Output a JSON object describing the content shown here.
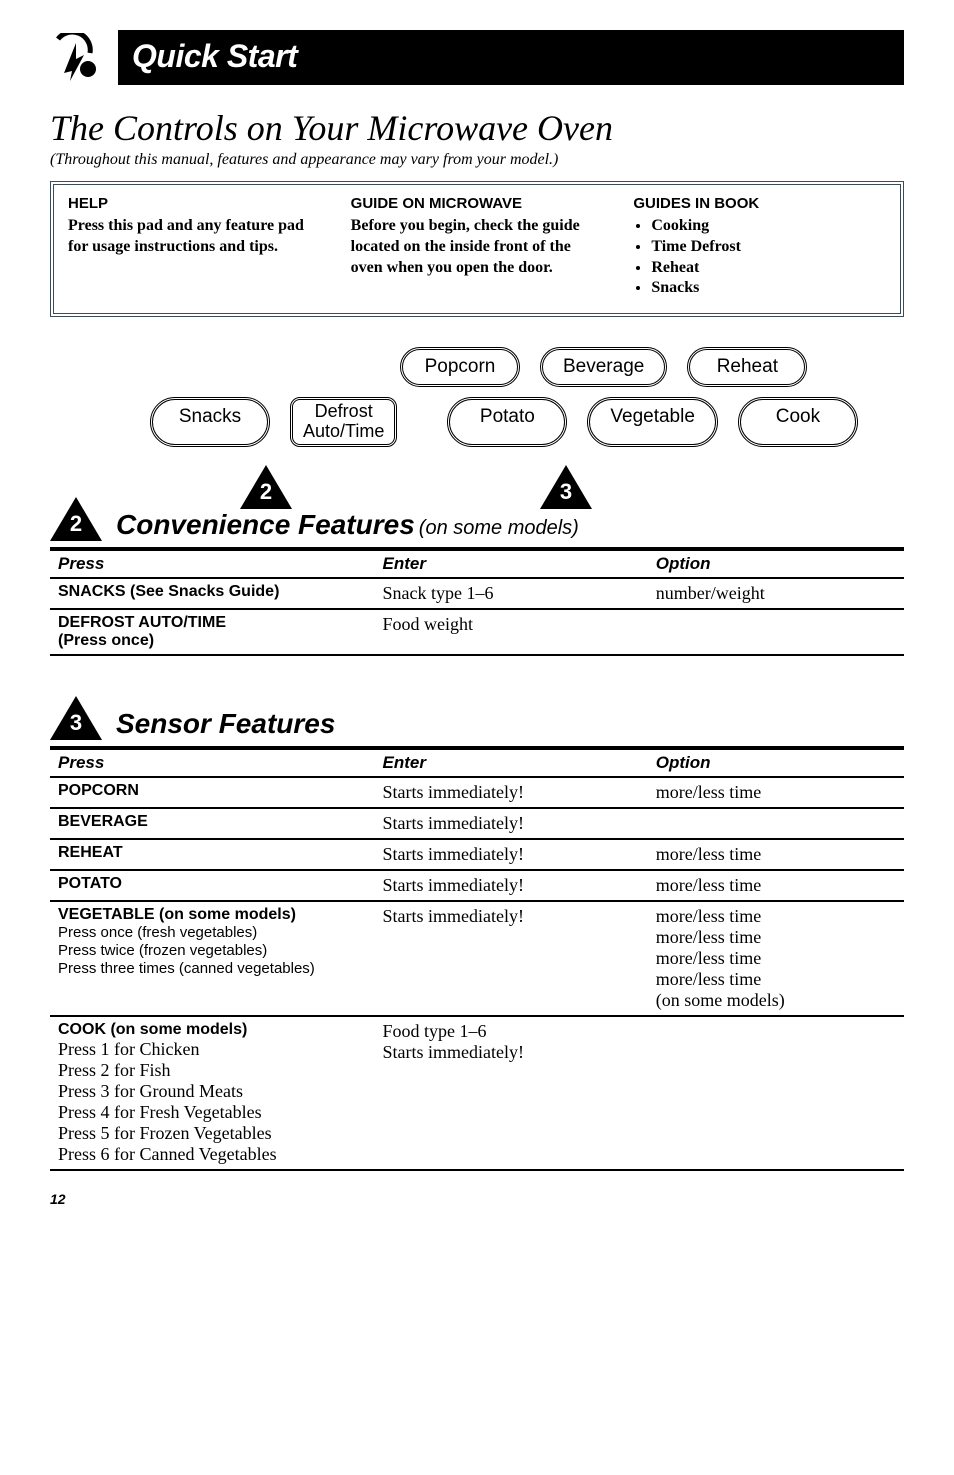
{
  "header": {
    "title": "Quick Start"
  },
  "section": {
    "title": "The Controls on Your Microwave Oven",
    "subtitle": "(Throughout this manual, features and appearance may vary from your model.)"
  },
  "guide": {
    "help": {
      "head": "HELP",
      "body": "Press this pad and any feature pad for usage instructions and tips."
    },
    "micro": {
      "head": "GUIDE ON MICROWAVE",
      "body": "Before you begin, check the guide located on the inside front of the oven when you open the door."
    },
    "book": {
      "head": "GUIDES IN BOOK",
      "items": [
        "Cooking",
        "Time Defrost",
        "Reheat",
        "Snacks"
      ]
    }
  },
  "buttons": {
    "popcorn": "Popcorn",
    "beverage": "Beverage",
    "reheat": "Reheat",
    "snacks": "Snacks",
    "defrost1": "Defrost",
    "defrost2": "Auto/Time",
    "potato": "Potato",
    "vegetable": "Vegetable",
    "cook": "Cook"
  },
  "markers": {
    "two": "2",
    "three": "3"
  },
  "convenience": {
    "heading": "Convenience Features",
    "sub": "(on some models)",
    "th": {
      "press": "Press",
      "enter": "Enter",
      "option": "Option"
    },
    "rows": [
      {
        "press": "SNACKS (See Snacks Guide)",
        "enter": "Snack type 1–6",
        "option": "number/weight"
      },
      {
        "press": "DEFROST AUTO/TIME",
        "press2": "(Press once)",
        "enter": "Food weight",
        "option": ""
      }
    ]
  },
  "sensor": {
    "heading": "Sensor Features",
    "th": {
      "press": "Press",
      "enter": "Enter",
      "option": "Option"
    },
    "rows": {
      "popcorn": {
        "p": "POPCORN",
        "e": "Starts immediately!",
        "o": "more/less time"
      },
      "beverage": {
        "p": "BEVERAGE",
        "e": "Starts immediately!",
        "o": ""
      },
      "reheat": {
        "p": "REHEAT",
        "e": "Starts immediately!",
        "o": "more/less time"
      },
      "potato": {
        "p": "POTATO",
        "e": "Starts immediately!",
        "o": "more/less time"
      },
      "veg": {
        "p": "VEGETABLE (on some models)",
        "s1": "Press once (fresh vegetables)",
        "s2": "Press twice (frozen vegetables)",
        "s3": "Press three times (canned vegetables)",
        "e": "Starts immediately!",
        "o1": "more/less time",
        "o2": "more/less time",
        "o3": "more/less time",
        "o4": "more/less time",
        "o5": "(on some models)"
      },
      "cook": {
        "p": "COOK (on some models)",
        "s1": "Press 1 for Chicken",
        "s2": "Press 2 for Fish",
        "s3": "Press 3 for Ground Meats",
        "s4": "Press 4 for Fresh Vegetables",
        "s5": "Press 5 for Frozen Vegetables",
        "s6": "Press 6 for Canned Vegetables",
        "e1": "Food type 1–6",
        "e2": "Starts immediately!"
      }
    }
  },
  "page": "12"
}
